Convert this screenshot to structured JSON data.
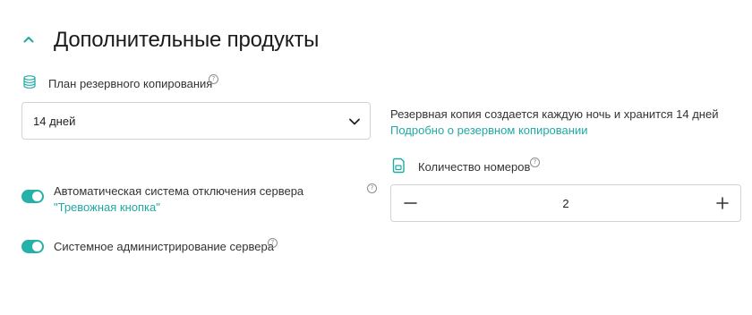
{
  "section": {
    "title": "Дополнительные продукты",
    "collapse_icon": "chevron-up-icon"
  },
  "backup": {
    "label": "План резервного копирования",
    "icon": "database-icon",
    "help": "?",
    "selected": "14 дней",
    "note": "Резервная копия создается каждую ночь и хранится 14 дней",
    "link": "Подробно о резервном копировании"
  },
  "toggles": [
    {
      "label": "Автоматическая система отключения сервера ",
      "link": "\"Тревожная кнопка\"",
      "checked": true
    },
    {
      "label": "Системное администрирование сервера",
      "checked": true
    }
  ],
  "numbers": {
    "label": "Количество номеров",
    "icon": "sim-card-icon",
    "value": "2",
    "minus": "−",
    "plus": "+"
  },
  "colors": {
    "accent": "#24b1aa",
    "link": "#21a9a4",
    "border": "#d3d3d3"
  }
}
